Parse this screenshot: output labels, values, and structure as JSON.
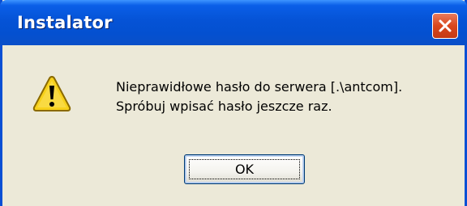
{
  "window": {
    "title": "Instalator",
    "close_icon": "close-icon"
  },
  "dialog": {
    "icon": "warning-icon",
    "message_line1": "Nieprawidłowe hasło do serwera [.\\antcom].",
    "message_line2": "Spróbuj wpisać hasło jeszcze raz."
  },
  "buttons": {
    "ok_label": "OK"
  },
  "colors": {
    "titlebar": "#0553d6",
    "dialog_bg": "#ece9d8",
    "close_button": "#d9461c",
    "warning_yellow": "#f7d11b"
  }
}
